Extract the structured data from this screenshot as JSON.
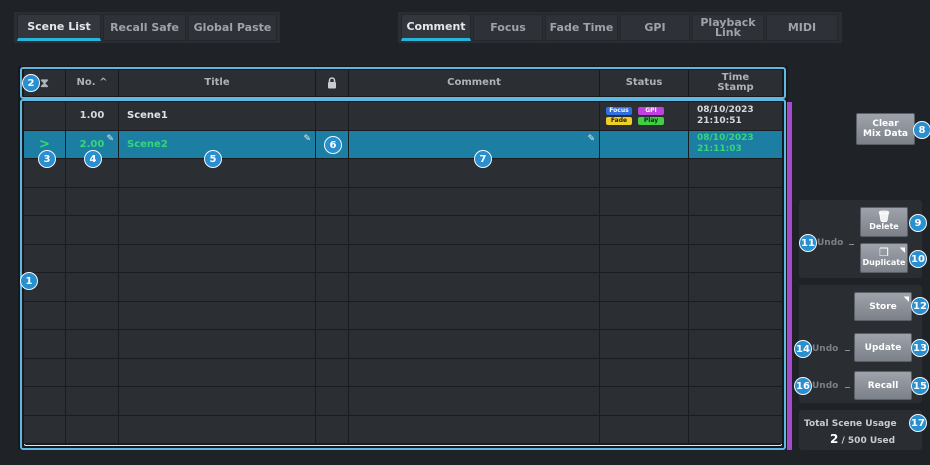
{
  "tabs_left": [
    {
      "label": "Scene List",
      "active": true
    },
    {
      "label": "Recall Safe",
      "active": false
    },
    {
      "label": "Global Paste",
      "active": false
    }
  ],
  "tabs_right": [
    {
      "label": "Comment",
      "active": true
    },
    {
      "label": "Focus",
      "active": false
    },
    {
      "label": "Fade Time",
      "active": false
    },
    {
      "label": "GPI",
      "active": false
    },
    {
      "label": "Playback\nLink",
      "active": false
    },
    {
      "label": "MIDI",
      "active": false
    }
  ],
  "table": {
    "headers": {
      "sort_icon": "⧗",
      "no": "No. ^",
      "title": "Title",
      "lock_icon": "lock-icon",
      "comment": "Comment",
      "status": "Status",
      "timestamp": "Time\nStamp"
    },
    "rows": [
      {
        "no": "1.00",
        "title": "Scene1",
        "date": "08/10/2023",
        "time": "21:10:51",
        "badges": [
          "Focus",
          "GPI",
          "Fade",
          "Play"
        ]
      },
      {
        "no": "2.00",
        "title": "Scene2",
        "date": "08/10/2023",
        "time": "21:11:03",
        "selected": true,
        "current_indicator": ">"
      }
    ],
    "empty_rows": 10
  },
  "badge_colors": {
    "Focus": "#2f6fe0",
    "GPI": "#c040e0",
    "Fade": "#f0d020",
    "Play": "#40d040"
  },
  "accent": "#29b3d8",
  "selected_row_color": "#1d7ea3",
  "selected_text_color": "#35d67a",
  "right_panel": {
    "clear_mix_data": "Clear\nMix Data",
    "delete": "Delete",
    "duplicate": "Duplicate",
    "undo_delete": "Undo",
    "store": "Store",
    "update": "Update",
    "undo_update": "Undo",
    "recall": "Recall",
    "undo_recall": "Undo",
    "total_usage_label": "Total Scene Usage",
    "used_count": "2",
    "used_total": "/ 500 Used"
  },
  "markers": [
    "1",
    "2",
    "3",
    "4",
    "5",
    "6",
    "7",
    "8",
    "9",
    "10",
    "11",
    "12",
    "13",
    "14",
    "15",
    "16",
    "17"
  ]
}
